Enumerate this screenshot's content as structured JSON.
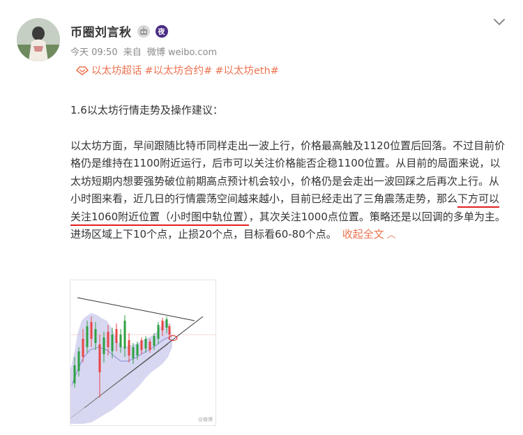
{
  "user": {
    "name": "币圈刘言秋",
    "robot_badge_icon": "robot-icon",
    "night_badge": "夜"
  },
  "meta": {
    "time": "今天 09:50",
    "source_prefix": "来自",
    "source": "微博 weibo.com"
  },
  "topics": {
    "super_topic": "以太坊超话",
    "tags": [
      "#以太坊合约#",
      "#以太坊eth#"
    ]
  },
  "post": {
    "heading": "1.6以太坊行情走势及操作建议：",
    "body_before_underline": "以太坊方面，早间跟随比特币同样走出一波上行，价格最高触及1120位置后回落。不过目前价格仍是维持在1100附近运行，后市可以关注价格能否企稳1100位置。从目前的局面来说，以太坊短期内想要强势破位前期高点预计机会较小，价格仍是会走出一波回踩之后再次上行。从小时图来看，近几日的行情震荡空间越来越小，目前已经走出了三角震荡走势，那么",
    "underlined": "下方可以关注1060附近位置（小时图中轨位置）",
    "body_after_underline": "，其次关注1000点位置。策略还是以回调的多单为主。进场区域上下10个点，止损20个点，目标看60-80个点。",
    "collapse_label": "收起全文"
  },
  "chart_image": {
    "watermark": "@微博"
  },
  "colors": {
    "accent": "#eb7350",
    "underline": "#e02020",
    "candle_up": "#2ea043",
    "candle_down": "#e84545",
    "band_fill": "#c9c9ee"
  }
}
